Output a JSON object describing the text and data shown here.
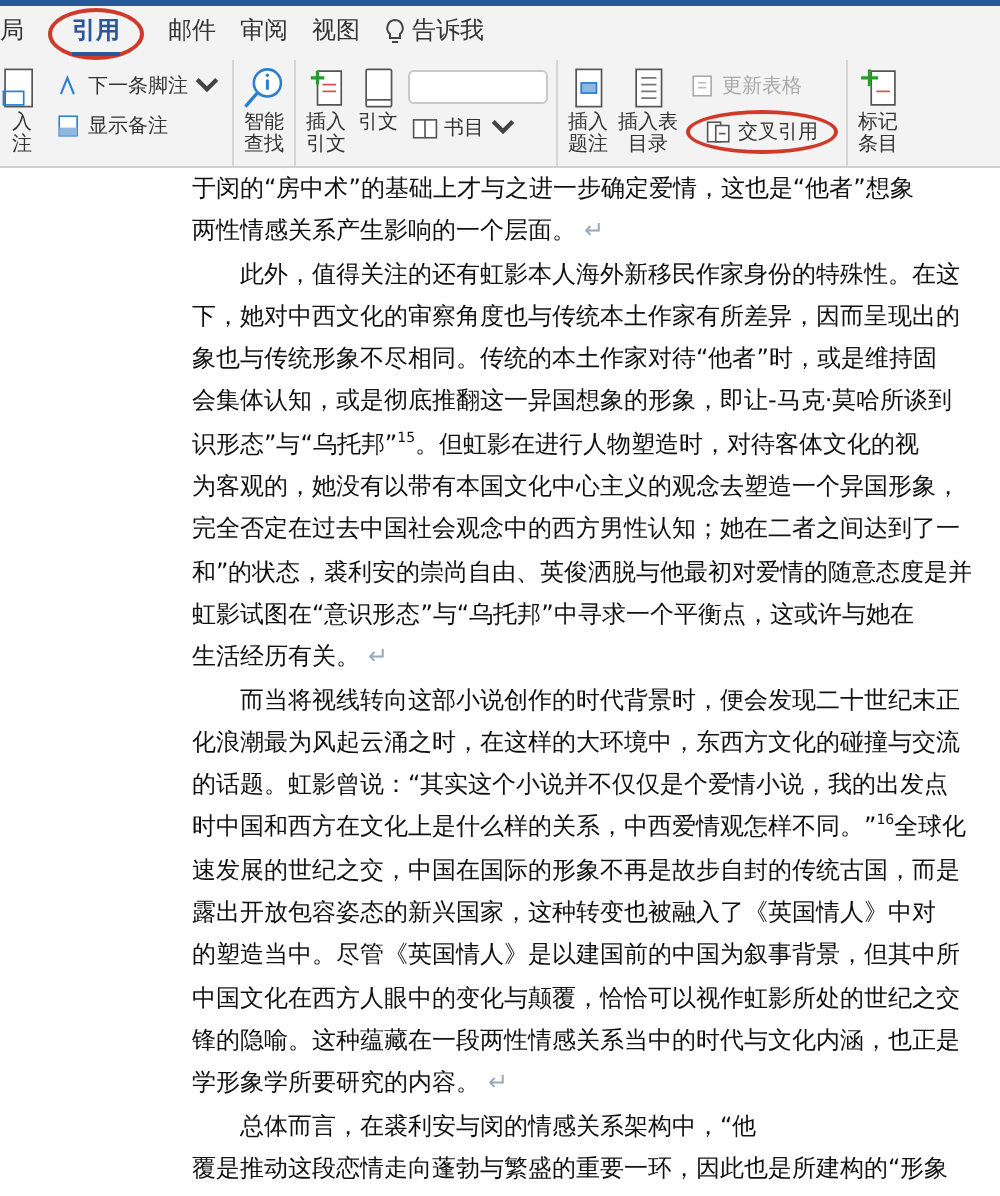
{
  "tabs": [
    {
      "label": "局",
      "selected": false,
      "circled": false
    },
    {
      "label": "引用",
      "selected": true,
      "circled": true
    },
    {
      "label": "邮件",
      "selected": false,
      "circled": false
    },
    {
      "label": "审阅",
      "selected": false,
      "circled": false
    },
    {
      "label": "视图",
      "selected": false,
      "circled": false
    },
    {
      "label": "告诉我",
      "selected": false,
      "circled": false,
      "kind": "help"
    }
  ],
  "ribbon": {
    "groups": [
      {
        "columns": [
          {
            "kind": "large",
            "lines": [
              "入",
              "注"
            ]
          },
          {
            "kind": "stack",
            "items": [
              {
                "label": "下一条脚注",
                "caret": true,
                "disabled": false,
                "circled": false
              },
              {
                "label": "显示备注",
                "caret": false,
                "disabled": false,
                "circled": false
              }
            ]
          }
        ]
      },
      {
        "columns": [
          {
            "kind": "large",
            "lines": [
              "智能",
              "查找"
            ]
          }
        ]
      },
      {
        "columns": [
          {
            "kind": "large",
            "lines": [
              "插入",
              "引文"
            ]
          },
          {
            "kind": "large",
            "lines": [
              "引文"
            ]
          },
          {
            "kind": "stack",
            "items": [
              {
                "kind": "combo"
              },
              {
                "label": "书目",
                "caret": true,
                "disabled": false,
                "circled": false
              }
            ]
          }
        ]
      },
      {
        "columns": [
          {
            "kind": "large",
            "lines": [
              "插入",
              "题注"
            ]
          },
          {
            "kind": "large",
            "lines": [
              "插入表",
              "目录"
            ]
          },
          {
            "kind": "stack",
            "items": [
              {
                "label": "更新表格",
                "caret": false,
                "disabled": true,
                "circled": false
              },
              {
                "label": "交叉引用",
                "caret": false,
                "disabled": false,
                "circled": true
              }
            ]
          }
        ]
      },
      {
        "columns": [
          {
            "kind": "large",
            "lines": [
              "标记",
              "条目"
            ]
          }
        ]
      }
    ]
  },
  "document": {
    "paragraphs": [
      {
        "indent": false,
        "end_mark": "↵",
        "lines": [
          "于闵的“房中术”的基础上才与之进一步确定爱情，这也是“他者”想象",
          "两性情感关系产生影响的一个层面。"
        ]
      },
      {
        "indent": true,
        "end_mark": "↵",
        "lines": [
          "此外，值得关注的还有虹影本人海外新移民作家身份的特殊性。在这",
          "下，她对中西文化的审察角度也与传统本土作家有所差异，因而呈现出的",
          "象也与传统形象不尽相同。传统的本土作家对待“他者”时，或是维持固",
          "会集体认知，或是彻底推翻这一异国想象的形象，即让-马克·莫哈所谈到",
          "识形态”与“乌托邦”$^{15}$。但虹影在进行人物塑造时，对待客体文化的视",
          "为客观的，她没有以带有本国文化中心主义的观念去塑造一个异国形象，",
          "完全否定在过去中国社会观念中的西方男性认知；她在二者之间达到了一",
          "和”的状态，裘利安的崇尚自由、英俊洒脱与他最初对爱情的随意态度是并",
          "虹影试图在“意识形态”与“乌托邦”中寻求一个平衡点，这或许与她在",
          "生活经历有关。"
        ]
      },
      {
        "indent": true,
        "end_mark": "↵",
        "lines": [
          "而当将视线转向这部小说创作的时代背景时，便会发现二十世纪末正",
          "化浪潮最为风起云涌之时，在这样的大环境中，东西方文化的碰撞与交流",
          "的话题。虹影曾说：“其实这个小说并不仅仅是个爱情小说，我的出发点",
          "时中国和西方在文化上是什么样的关系，中西爱情观怎样不同。”$^{16}$全球化",
          "速发展的世纪之交，中国在国际的形象不再是故步自封的传统古国，而是",
          "露出开放包容姿态的新兴国家，这种转变也被融入了《英国情人》中对",
          "的塑造当中。尽管《英国情人》是以建国前的中国为叙事背景，但其中所",
          "中国文化在西方人眼中的变化与颠覆，恰恰可以视作虹影所处的世纪之交",
          "锋的隐喻。这种蕴藏在一段两性情感关系当中的时代与文化内涵，也正是",
          "学形象学所要研究的内容。"
        ]
      },
      {
        "indent": true,
        "lines": [
          "总体而言，在裘利安与闵的情感关系架构中，“他",
          "覆是推动这段恋情走向蓬勃与繁盛的重要一环，因此也是所建构的“形象"
        ]
      }
    ]
  }
}
